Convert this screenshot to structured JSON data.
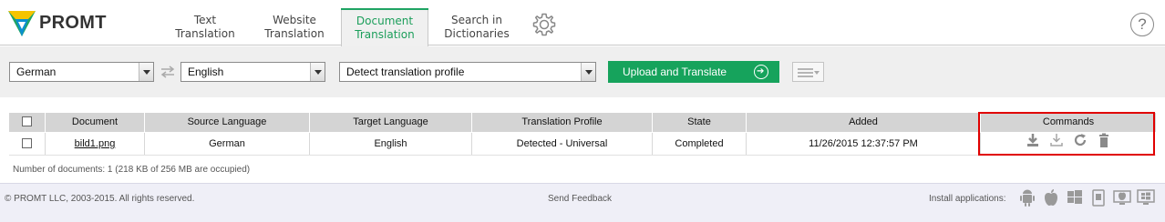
{
  "header": {
    "logo_text": "PROMT",
    "tabs": [
      {
        "line1": "Text",
        "line2": "Translation"
      },
      {
        "line1": "Website",
        "line2": "Translation"
      },
      {
        "line1": "Document",
        "line2": "Translation"
      },
      {
        "line1": "Search in",
        "line2": "Dictionaries"
      }
    ],
    "help_label": "?"
  },
  "toolbar": {
    "source_language": "German",
    "target_language": "English",
    "profile": "Detect translation profile",
    "upload_label": "Upload and Translate"
  },
  "table": {
    "headers": [
      "Document",
      "Source Language",
      "Target Language",
      "Translation Profile",
      "State",
      "Added",
      "Commands"
    ],
    "rows": [
      {
        "document": "bild1.png",
        "source": "German",
        "target": "English",
        "profile": "Detected - Universal",
        "state": "Completed",
        "added": "11/26/2015 12:37:57 PM"
      }
    ],
    "count_text": "Number of documents: 1 (218 KB of 256 MB are occupied)"
  },
  "footer": {
    "copyright": "© PROMT LLC, 2003-2015. All rights reserved.",
    "feedback": "Send Feedback",
    "install_label": "Install applications:",
    "apps": [
      "android-icon",
      "apple-icon",
      "windows-icon",
      "windows-phone-icon",
      "mac-icon",
      "windows-desktop-icon"
    ]
  },
  "colors": {
    "accent": "#16a35c",
    "highlight": "#e00000"
  }
}
